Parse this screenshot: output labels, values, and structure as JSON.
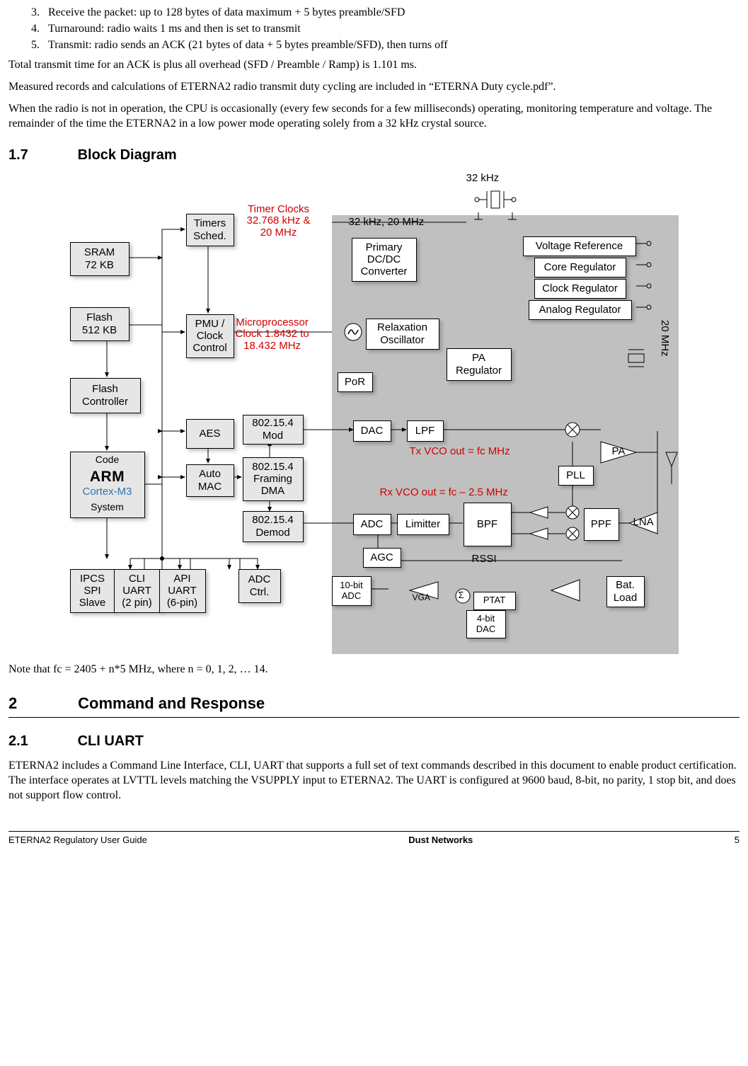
{
  "steps": {
    "s3": "Receive the packet: up to 128 bytes of data maximum + 5 bytes preamble/SFD",
    "s4": "Turnaround: radio waits 1 ms and then is set to transmit",
    "s5": "Transmit: radio sends an ACK (21 bytes of data + 5 bytes preamble/SFD), then turns off"
  },
  "body": {
    "p1": "Total transmit time for an ACK is plus all overhead (SFD / Preamble / Ramp) is 1.101 ms.",
    "p2": "Measured records and calculations of ETERNA2 radio transmit duty cycling are included in “ETERNA Duty cycle.pdf”.",
    "p3": "When the radio is not in operation, the CPU is occasionally (every few seconds for a few milliseconds) operating, monitoring temperature and voltage.  The remainder of the time the ETERNA2 in a low power mode operating solely from a 32 kHz crystal source.",
    "note_fc": "Note that fc = 2405 + n*5 MHz, where n = 0, 1, 2, … 14.",
    "cli_p": "ETERNA2 includes a Command Line Interface, CLI, UART that supports a full set of text commands described in this document to enable product certification.  The interface operates at LVTTL levels matching the VSUPPLY input to ETERNA2.  The UART is configured at 9600 baud, 8-bit, no parity, 1 stop bit, and does not support flow control."
  },
  "headings": {
    "h17_num": "1.7",
    "h17_title": "Block Diagram",
    "h2_num": "2",
    "h2_title": "Command and Response",
    "h21_num": "2.1",
    "h21_title": "CLI UART"
  },
  "diagram": {
    "sram": "SRAM\n72 KB",
    "flash": "Flash\n512 KB",
    "flashctrl": "Flash\nController",
    "timers": "Timers\nSched.",
    "pmu": "PMU /\nClock\nControl",
    "aes": "AES",
    "automac": "Auto\nMAC",
    "mod": "802.15.4\nMod",
    "framing": "802.15.4\nFraming\nDMA",
    "demod": "802.15.4\nDemod",
    "ipcs": "IPCS\nSPI\nSlave",
    "cliuart": "CLI\nUART\n(2 pin)",
    "apiuart": "API\nUART\n(6-pin)",
    "adcctrl": "ADC\nCtrl.",
    "primary": "Primary\nDC/DC\nConverter",
    "relax": "Relaxation\nOscillator",
    "por": "PoR",
    "pareg": "PA\nRegulator",
    "vref": "Voltage Reference",
    "coreg": "Core Regulator",
    "clkreg": "Clock Regulator",
    "anareg": "Analog Regulator",
    "dac": "DAC",
    "lpf": "LPF",
    "pa": "PA",
    "pll": "PLL",
    "adc": "ADC",
    "limitter": "Limitter",
    "bpf": "BPF",
    "ppf": "PPF",
    "lna": "LNA",
    "agc": "AGC",
    "tenbit": "10-bit\nADC",
    "vga": "VGA",
    "ptat": "PTAT",
    "fourbit": "4-bit\nDAC",
    "bat": "Bat.\nLoad",
    "rssi": "RSSI",
    "sigma": "Σ",
    "code": "Code",
    "system": "System",
    "arm": "ARM",
    "cortex": "Cortex-M3",
    "l32khz": "32 kHz",
    "l32_20": "32 kHz, 20 MHz",
    "l20mhz": "20 MHz",
    "timerclk1": "Timer Clocks",
    "timerclk2": "32.768 kHz &",
    "timerclk3": "20 MHz",
    "mp1": "Microprocessor",
    "mp2": "Clock 1.8432 to",
    "mp3": "18.432 MHz",
    "txvco": "Tx VCO out = fc MHz",
    "rxvco": "Rx VCO out = fc – 2.5 MHz"
  },
  "footer": {
    "left": "ETERNA2 Regulatory User Guide",
    "center": "Dust Networks",
    "right": "5"
  }
}
